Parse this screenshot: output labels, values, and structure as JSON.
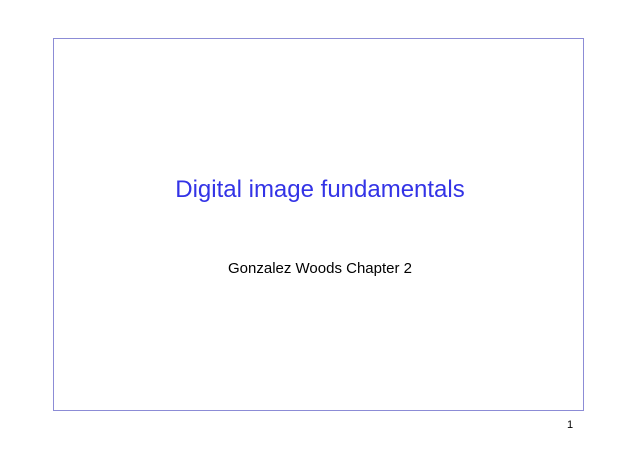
{
  "slide": {
    "title": "Digital image fundamentals",
    "subtitle": "Gonzalez Woods Chapter 2",
    "page_number": "1"
  },
  "colors": {
    "title": "#3333e6",
    "frame_border": "#8c8cd6",
    "text": "#000000",
    "background": "#ffffff"
  }
}
